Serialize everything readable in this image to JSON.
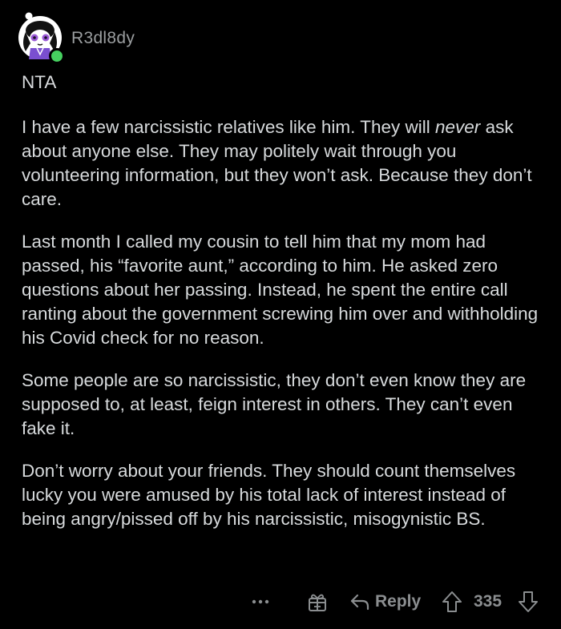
{
  "comment": {
    "username": "R3dl8dy",
    "status_color": "#46d160",
    "paragraphs": [
      {
        "text": "NTA"
      },
      {
        "pre": "I have a few narcissistic relatives like him. They will ",
        "em": "never",
        "post": " ask about anyone else. They may politely wait through you volunteering information, but they won’t ask. Because they don’t care."
      },
      {
        "text": "Last month I called my cousin to tell him that my mom had passed, his “favorite aunt,” according to him. He asked zero questions about her passing. Instead, he spent the entire call ranting about the government screwing him over and withholding his Covid check for no reason."
      },
      {
        "text": "Some people are so narcissistic, they don’t even know they are supposed to, at least, feign interest in others. They can’t even fake it."
      },
      {
        "text": "Don’t worry about your friends. They should count themselves lucky you were amused by his total lack of interest instead of being angry/pissed off by his narcissistic, misogynistic BS."
      }
    ]
  },
  "actions": {
    "more_icon": "more-horizontal-icon",
    "award_icon": "gift-icon",
    "reply_label": "Reply",
    "reply_icon": "reply-arrow-icon",
    "upvote_icon": "up-arrow-icon",
    "score": "335",
    "downvote_icon": "down-arrow-icon"
  },
  "colors": {
    "background": "#000000",
    "text": "#d7dadc",
    "muted": "#8b8e90"
  }
}
